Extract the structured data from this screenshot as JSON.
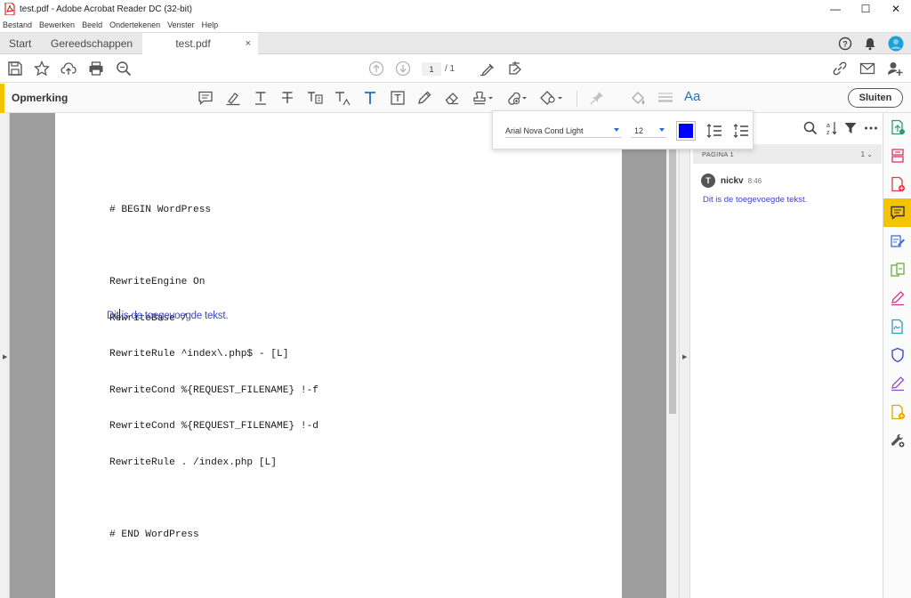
{
  "window": {
    "title": "test.pdf - Adobe Acrobat Reader DC (32-bit)",
    "minimize": "—",
    "maximize": "☐",
    "close": "✕"
  },
  "menu": [
    "Bestand",
    "Bewerken",
    "Beeld",
    "Ondertekenen",
    "Venster",
    "Help"
  ],
  "tabs": {
    "start": "Start",
    "tools": "Gereedschappen",
    "file": "test.pdf",
    "file_close": "×"
  },
  "toolbar": {
    "page_current": "1",
    "page_total": "/ 1"
  },
  "comment_toolbar": {
    "label": "Opmerking",
    "close_label": "Sluiten"
  },
  "text_properties": {
    "font": "Arial Nova Cond Light",
    "size": "12",
    "color": "#0000ff"
  },
  "document": {
    "code_lines": [
      "# BEGIN WordPress",
      "",
      "RewriteEngine On",
      "RewriteBase /",
      "RewriteRule ^index\\.php$ - [L]",
      "RewriteCond %{REQUEST_FILENAME} !-f",
      "RewriteCond %{REQUEST_FILENAME} !-d",
      "RewriteRule . /index.php [L]",
      "",
      "# END WordPress"
    ],
    "added_text_before_caret": "Dit",
    "added_text_after_caret": "is de toegevoegde tekst.",
    "added_text_color": "#3a47c7"
  },
  "comments_panel": {
    "page_label": "PAGINA 1",
    "page_count": "1",
    "comment": {
      "avatar_letter": "T",
      "author": "nickv",
      "time": "8:46",
      "text": "Dit is de toegevoegde tekst."
    }
  },
  "colors": {
    "accent_yellow": "#f5c400",
    "link_blue": "#2a6fce"
  }
}
